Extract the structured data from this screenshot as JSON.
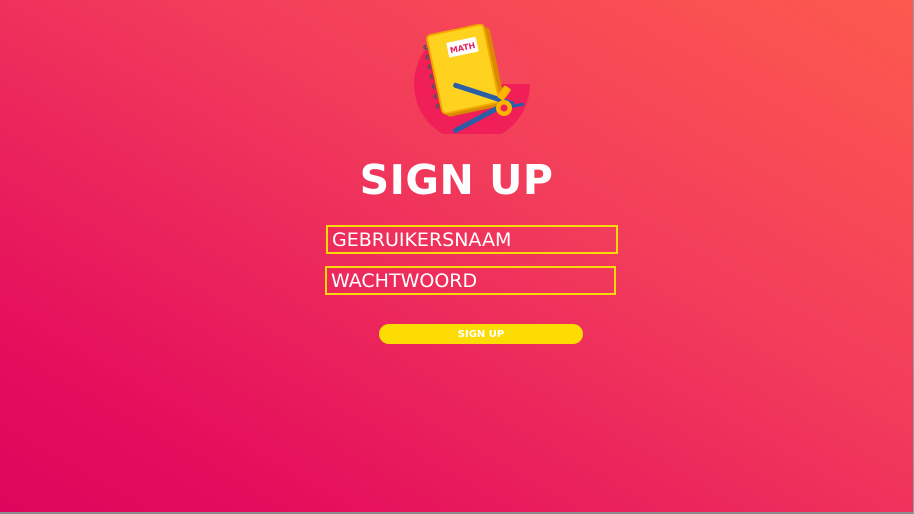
{
  "page": {
    "title": "SIGN UP"
  },
  "logo": {
    "book_label": "MATH",
    "icon": "math-book-compass-icon"
  },
  "form": {
    "username_placeholder": "GEBRUIKERSNAAM",
    "password_placeholder": "WACHTWOORD",
    "submit_label": "SIGN UP"
  },
  "colors": {
    "background_start": "#fd5a4e",
    "background_end": "#de065c",
    "accent_yellow": "#fddc04",
    "text": "#ffffff"
  }
}
